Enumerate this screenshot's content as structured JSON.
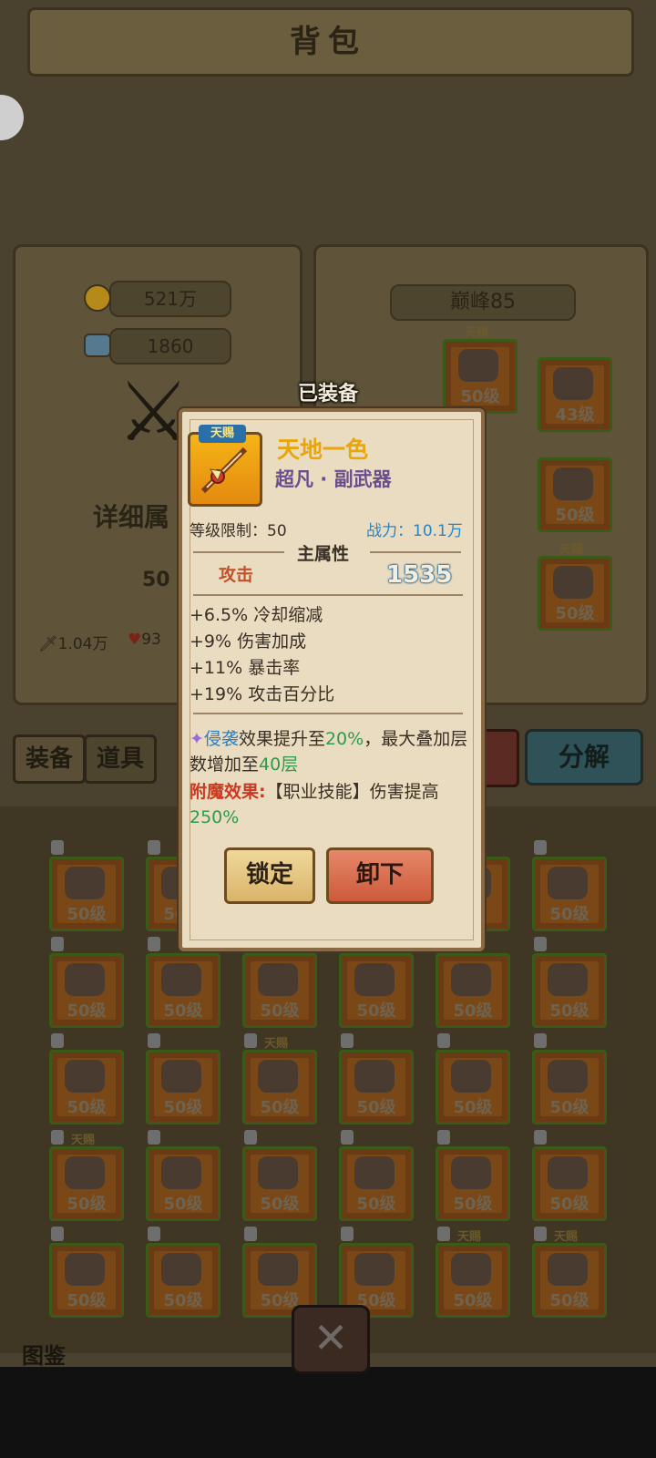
{
  "header": {
    "title": "背包"
  },
  "left_panel": {
    "gold": "521万",
    "gems": "1860",
    "detail_label": "详细属",
    "level_partial": "50",
    "attack": "1.04万",
    "hp_partial": "93"
  },
  "right_panel": {
    "peak": "巅峰85"
  },
  "tabs": {
    "equip": "装备",
    "items": "道具"
  },
  "decompose": "分解",
  "atlas": "图鉴",
  "close": "✕",
  "popup": {
    "equipped_label": "已装备",
    "tianci": "天赐",
    "item_name": "天地一色",
    "item_type": "超凡 · 副武器",
    "level_req": "等级限制：50",
    "power": "战力：10.1万",
    "main_attr_title": "主属性",
    "attack_label": "攻击",
    "attack_value": "1535",
    "substats": [
      "+6.5% 冷却缩减",
      "+9% 伤害加成",
      "+11% 暴击率",
      "+19% 攻击百分比"
    ],
    "effect": {
      "skill": "侵袭",
      "text1": "效果提升至",
      "v1": "20%",
      "text2": "，最大叠加层数增加至",
      "v2": "40层"
    },
    "enchant": {
      "label": "附魔效果:",
      "text": "【职业技能】伤害提高",
      "value": "250%"
    },
    "lock_button": "锁定",
    "unload_button": "卸下"
  },
  "grid": {
    "level_text": "50级",
    "tianci": "天赐",
    "slots": [
      {
        "level": "50级",
        "tianci": false
      },
      {
        "level": "50级",
        "tianci": false
      },
      {
        "level": "",
        "tianci": false
      },
      {
        "level": "",
        "tianci": false
      },
      {
        "level": "",
        "tianci": false
      },
      {
        "level": "50级",
        "tianci": false
      },
      {
        "level": "50级",
        "tianci": false
      },
      {
        "level": "50级",
        "tianci": false
      },
      {
        "level": "50级",
        "tianci": false
      },
      {
        "level": "50级",
        "tianci": false
      },
      {
        "level": "50级",
        "tianci": false
      },
      {
        "level": "50级",
        "tianci": false
      },
      {
        "level": "50级",
        "tianci": false
      },
      {
        "level": "50级",
        "tianci": false
      },
      {
        "level": "50级",
        "tianci": true
      },
      {
        "level": "50级",
        "tianci": false
      },
      {
        "level": "50级",
        "tianci": false
      },
      {
        "level": "50级",
        "tianci": false
      },
      {
        "level": "50级",
        "tianci": true
      },
      {
        "level": "50级",
        "tianci": false
      },
      {
        "level": "50级",
        "tianci": false
      },
      {
        "level": "50级",
        "tianci": false
      },
      {
        "level": "50级",
        "tianci": false
      },
      {
        "level": "50级",
        "tianci": false
      },
      {
        "level": "50级",
        "tianci": false
      },
      {
        "level": "50级",
        "tianci": false
      },
      {
        "level": "50级",
        "tianci": false
      },
      {
        "level": "50级",
        "tianci": false
      },
      {
        "level": "50级",
        "tianci": true
      },
      {
        "level": "50级",
        "tianci": true
      }
    ]
  },
  "equipped_slots": [
    {
      "level": "50级",
      "tianci": true
    },
    {
      "level": "43级",
      "tianci": false
    },
    {
      "level": "50级",
      "tianci": false
    },
    {
      "level": "50级",
      "tianci": true
    }
  ],
  "colors": {
    "item_name": "#e8a60a",
    "item_type": "#6a4d8c",
    "power": "#2a84c8",
    "highlight_green": "#2f9a4b",
    "enchant_red": "#c83b22"
  }
}
